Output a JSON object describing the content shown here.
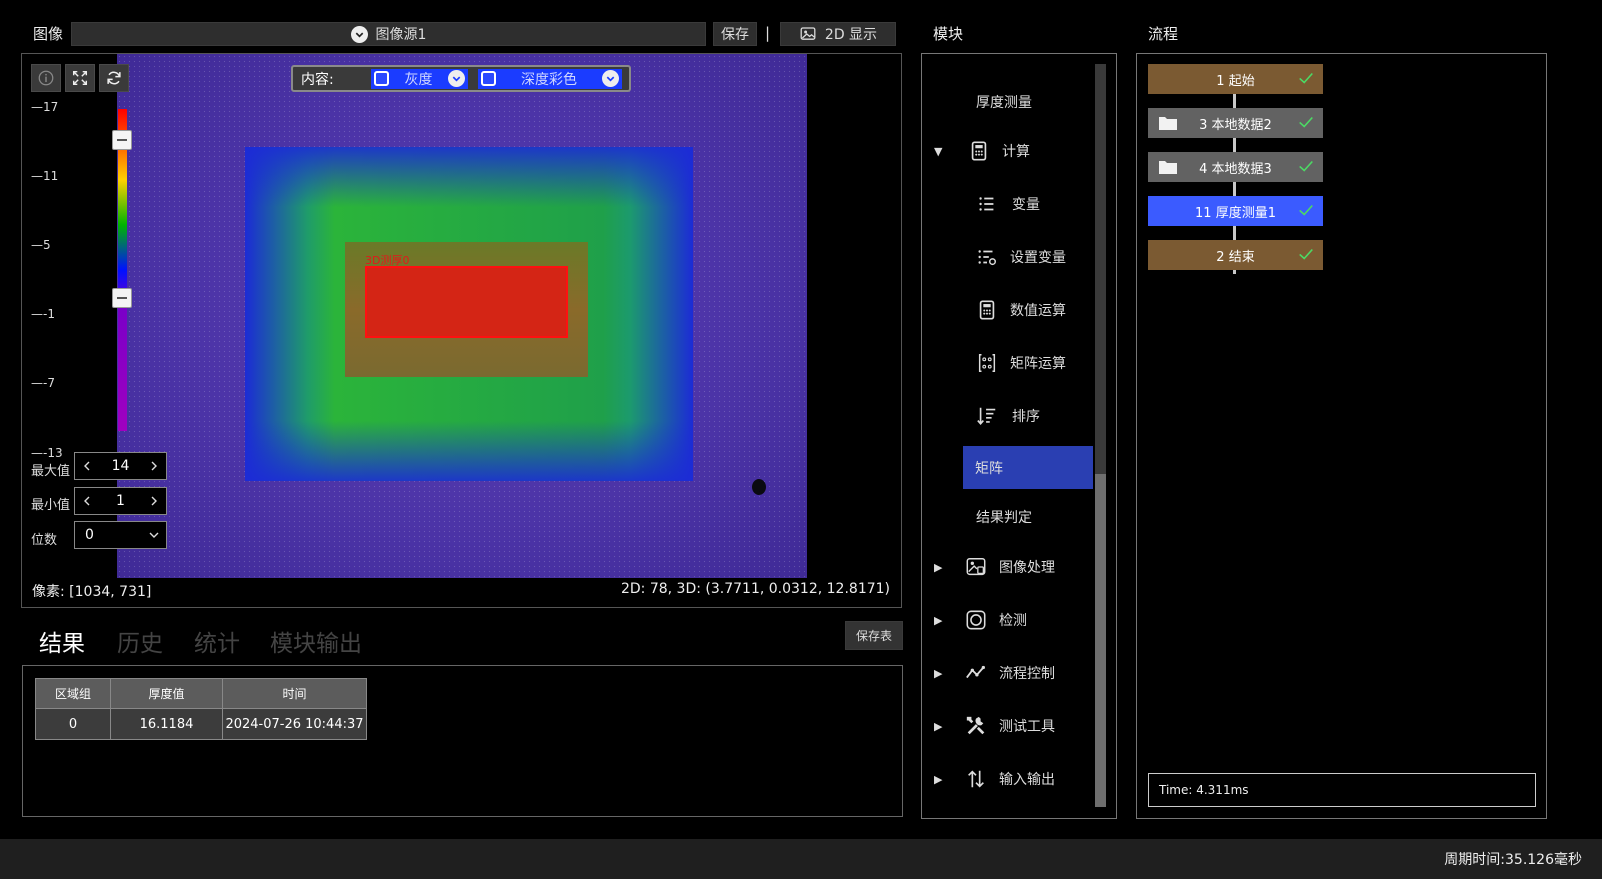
{
  "image_panel": {
    "title": "图像",
    "source": "图像源1",
    "save_label": "保存",
    "separator": "|",
    "view_mode_label": "2D 显示",
    "content_label": "内容:",
    "gray_label": "灰度",
    "depth_color_label": "深度彩色",
    "roi_label": "3D测厚0",
    "scale_ticks": [
      "17",
      "11",
      "5",
      "-1",
      "-7",
      "-13"
    ],
    "max_label": "最大值",
    "max_value": "14",
    "min_label": "最小值",
    "min_value": "1",
    "digits_label": "位数",
    "digits_value": "0",
    "pixel_readout": "像素: [1034, 731]",
    "coord_readout": "2D: 78, 3D: (3.7711, 0.0312, 12.8171)"
  },
  "results": {
    "tabs": [
      "结果",
      "历史",
      "统计",
      "模块输出"
    ],
    "save_table_label": "保存表",
    "columns": [
      "区域组",
      "厚度值",
      "时间"
    ],
    "rows": [
      [
        "0",
        "16.1184",
        "2024-07-26 10:44:37"
      ]
    ]
  },
  "modules": {
    "title": "模块",
    "items": [
      {
        "label": "厚度测量",
        "icon": "none"
      },
      {
        "label": "计算",
        "icon": "calculator-icon"
      },
      {
        "label": "变量",
        "icon": "list-icon"
      },
      {
        "label": "设置变量",
        "icon": "list-settings-icon"
      },
      {
        "label": "数值运算",
        "icon": "calculator-icon"
      },
      {
        "label": "矩阵运算",
        "icon": "matrix-icon"
      },
      {
        "label": "排序",
        "icon": "sort-icon"
      },
      {
        "label": "矩阵",
        "icon": "none"
      },
      {
        "label": "结果判定",
        "icon": "none"
      },
      {
        "label": "图像处理",
        "icon": "image-process-icon"
      },
      {
        "label": "检测",
        "icon": "camera-frame-icon"
      },
      {
        "label": "流程控制",
        "icon": "trend-icon"
      },
      {
        "label": "测试工具",
        "icon": "tools-icon"
      },
      {
        "label": "输入输出",
        "icon": "swap-icon"
      }
    ]
  },
  "flow": {
    "title": "流程",
    "nodes": [
      {
        "label": "1 起始",
        "color": "#7b5a32"
      },
      {
        "label": "3 本地数据2",
        "color": "#626262"
      },
      {
        "label": "4 本地数据3",
        "color": "#626262"
      },
      {
        "label": "11 厚度测量1",
        "color": "#3b5bff"
      },
      {
        "label": "2 结束",
        "color": "#7b5a32"
      }
    ],
    "time_text": "Time: 4.311ms"
  },
  "footer": {
    "cycle_time": "周期时间:35.126毫秒"
  }
}
